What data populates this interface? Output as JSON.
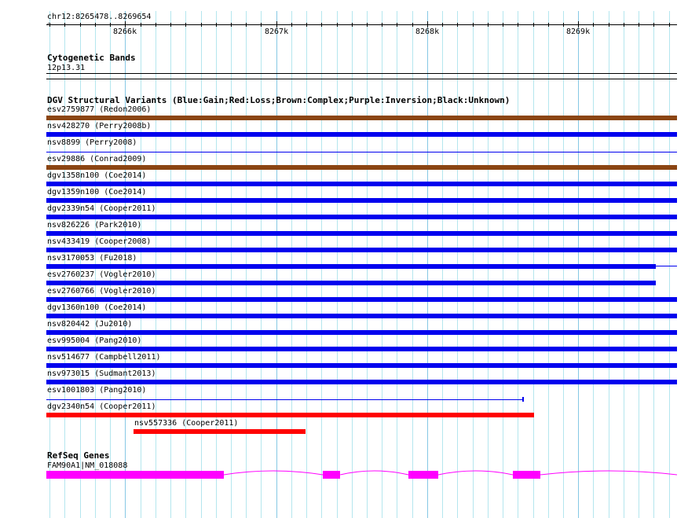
{
  "region": {
    "label": "chr12:8265478..8269654",
    "chrom": "chr12",
    "start": 8265478,
    "end": 8269654
  },
  "ruler": {
    "major_labels": [
      {
        "pos": 8266000,
        "label": "8266k"
      },
      {
        "pos": 8267000,
        "label": "8267k"
      },
      {
        "pos": 8268000,
        "label": "8268k"
      },
      {
        "pos": 8269000,
        "label": "8269k"
      }
    ],
    "minor_step": 100
  },
  "cytoband": {
    "title": "Cytogenetic Bands",
    "band": "12p13.31"
  },
  "dgv": {
    "title": "DGV Structural Variants (Blue:Gain;Red:Loss;Brown:Complex;Purple:Inversion;Black:Unknown)",
    "colors": {
      "gain": "#0000ee",
      "loss": "#ff0000",
      "complex": "#8b4513"
    },
    "features": [
      {
        "label": "esv2759877 (Redon2006)",
        "type": "complex",
        "style": "thick",
        "start": 8265478,
        "end": 8269654
      },
      {
        "label": "nsv428270 (Perry2008b)",
        "type": "gain",
        "style": "thick",
        "start": 8265478,
        "end": 8269654
      },
      {
        "label": "nsv8899 (Perry2008)",
        "type": "gain",
        "style": "thin",
        "start": 8265478,
        "end": 8269654
      },
      {
        "label": "esv29886 (Conrad2009)",
        "type": "complex",
        "style": "thick",
        "start": 8265478,
        "end": 8269654
      },
      {
        "label": "dgv1358n100 (Coe2014)",
        "type": "gain",
        "style": "thick",
        "start": 8265478,
        "end": 8269654
      },
      {
        "label": "dgv1359n100 (Coe2014)",
        "type": "gain",
        "style": "thick",
        "start": 8265478,
        "end": 8269654
      },
      {
        "label": "dgv2339n54 (Cooper2011)",
        "type": "gain",
        "style": "thick",
        "start": 8265478,
        "end": 8269654
      },
      {
        "label": "nsv826226 (Park2010)",
        "type": "gain",
        "style": "thick",
        "start": 8265478,
        "end": 8269654
      },
      {
        "label": "nsv433419 (Cooper2008)",
        "type": "gain",
        "style": "thick",
        "start": 8265478,
        "end": 8269654
      },
      {
        "label": "nsv3170053 (Fu2018)",
        "type": "gain",
        "style": "thick",
        "start": 8265478,
        "end": 8269513,
        "tail_end": 8269654
      },
      {
        "label": "esv2760237 (Vogler2010)",
        "type": "gain",
        "style": "thick",
        "start": 8265478,
        "end": 8269513
      },
      {
        "label": "esv2760766 (Vogler2010)",
        "type": "gain",
        "style": "thick",
        "start": 8265478,
        "end": 8269654
      },
      {
        "label": "dgv1360n100 (Coe2014)",
        "type": "gain",
        "style": "thick",
        "start": 8265478,
        "end": 8269654
      },
      {
        "label": "nsv820442 (Ju2010)",
        "type": "gain",
        "style": "thick",
        "start": 8265478,
        "end": 8269654
      },
      {
        "label": "esv995004 (Pang2010)",
        "type": "gain",
        "style": "thick",
        "start": 8265478,
        "end": 8269654
      },
      {
        "label": "nsv514677 (Campbell2011)",
        "type": "gain",
        "style": "thick",
        "start": 8265478,
        "end": 8269654
      },
      {
        "label": "nsv973015 (Sudmant2013)",
        "type": "gain",
        "style": "thick",
        "start": 8265478,
        "end": 8269654
      },
      {
        "label": "esv1001803 (Pang2010)",
        "type": "gain",
        "style": "thin-end",
        "start": 8265478,
        "end": 8268629
      },
      {
        "label": "dgv2340n54 (Cooper2011)",
        "type": "loss",
        "style": "thick",
        "start": 8265478,
        "end": 8268707
      },
      {
        "label": "nsv557336 (Cooper2011)",
        "type": "loss",
        "style": "thick",
        "start": 8266055,
        "end": 8267194
      }
    ]
  },
  "refseq": {
    "title": "RefSeq Genes",
    "gene_label": "FAM90A1|NM_018088",
    "color": "#ff00ff",
    "exons": [
      [
        8265478,
        8266653
      ],
      [
        8267309,
        8267424
      ],
      [
        8267876,
        8268073
      ],
      [
        8268567,
        8268749
      ]
    ],
    "end": 8269654
  }
}
